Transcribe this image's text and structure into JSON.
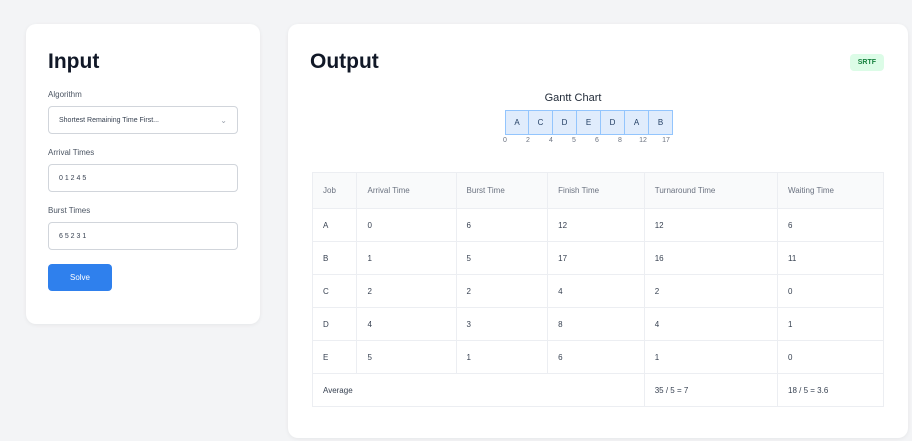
{
  "input": {
    "title": "Input",
    "algorithm_label": "Algorithm",
    "algorithm_value": "Shortest Remaining Time First...",
    "arrival_label": "Arrival Times",
    "arrival_value": "0 1 2 4 5",
    "burst_label": "Burst Times",
    "burst_value": "6 5 2 3 1",
    "solve_label": "Solve"
  },
  "output": {
    "title": "Output",
    "badge": "SRTF",
    "gantt_title": "Gantt Chart",
    "gantt_blocks": [
      "A",
      "C",
      "D",
      "E",
      "D",
      "A",
      "B"
    ],
    "gantt_ticks": [
      "0",
      "2",
      "4",
      "5",
      "6",
      "8",
      "12",
      "17"
    ],
    "table": {
      "headers": [
        "Job",
        "Arrival Time",
        "Burst Time",
        "Finish Time",
        "Turnaround Time",
        "Waiting Time"
      ],
      "rows": [
        [
          "A",
          "0",
          "6",
          "12",
          "12",
          "6"
        ],
        [
          "B",
          "1",
          "5",
          "17",
          "16",
          "11"
        ],
        [
          "C",
          "2",
          "2",
          "4",
          "2",
          "0"
        ],
        [
          "D",
          "4",
          "3",
          "8",
          "4",
          "1"
        ],
        [
          "E",
          "5",
          "1",
          "6",
          "1",
          "0"
        ]
      ],
      "average_label": "Average",
      "average_turnaround": "35 / 5 = 7",
      "average_waiting": "18 / 5 = 3.6"
    }
  },
  "colors": {
    "accent": "#2f80ed",
    "badge_bg": "#dcfce7",
    "badge_text": "#15803d",
    "gantt_fill": "#e0ecfc"
  }
}
